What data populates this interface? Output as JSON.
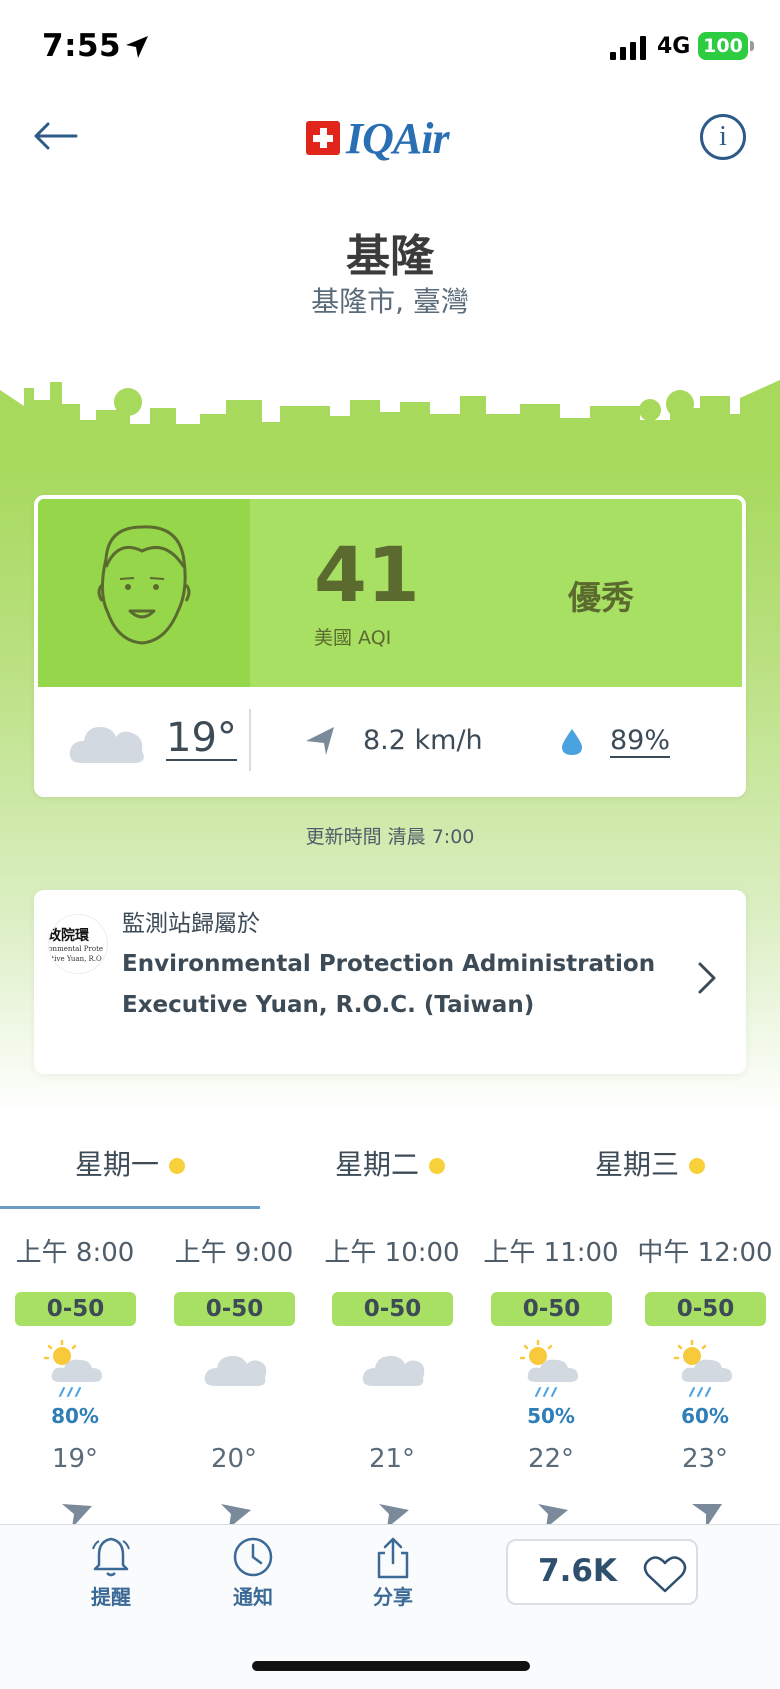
{
  "status_bar": {
    "time": "7:55",
    "network": "4G",
    "battery": "100"
  },
  "nav": {
    "logo_text": "IQAir",
    "back_icon": "arrow-left-icon",
    "info_icon": "info-icon"
  },
  "location": {
    "city": "基隆",
    "region": "基隆市, 臺灣"
  },
  "aqi": {
    "value": "41",
    "label": "美國 AQI",
    "status": "優秀",
    "face_icon": "happy-face-icon",
    "color": "#a8e063"
  },
  "weather": {
    "temperature": "19°",
    "wind_speed": "8.2 km/h",
    "humidity": "89%",
    "weather_icon": "cloud-icon",
    "wind_icon": "wind-direction-icon",
    "humidity_icon": "water-drop-icon"
  },
  "update": {
    "text": "更新時間 清晨 7:00"
  },
  "station": {
    "owner_label": "監測站歸屬於",
    "name": "Environmental Protection Administration Executive Yuan, R.O.C. (Taiwan)",
    "logo_text_1": "政院環",
    "logo_text_2": "ronmental Prote",
    "logo_text_3": "utive Yuan, R.O"
  },
  "day_tabs": [
    {
      "label": "星期一"
    },
    {
      "label": "星期二"
    },
    {
      "label": "星期三"
    }
  ],
  "hourly": [
    {
      "time": "上午 8:00",
      "aqi_range": "0-50",
      "icon": "partly-sunny-rain-icon",
      "precip": "80%",
      "temp": "19°"
    },
    {
      "time": "上午 9:00",
      "aqi_range": "0-50",
      "icon": "cloud-icon",
      "precip": "",
      "temp": "20°"
    },
    {
      "time": "上午 10:00",
      "aqi_range": "0-50",
      "icon": "cloud-icon",
      "precip": "",
      "temp": "21°"
    },
    {
      "time": "上午 11:00",
      "aqi_range": "0-50",
      "icon": "partly-sunny-rain-icon",
      "precip": "50%",
      "temp": "22°"
    },
    {
      "time": "中午 12:00",
      "aqi_range": "0-50",
      "icon": "partly-sunny-rain-icon",
      "precip": "60%",
      "temp": "23°"
    }
  ],
  "toolbar": {
    "alert_label": "提醒",
    "notify_label": "通知",
    "share_label": "分享",
    "like_count": "7.6K"
  }
}
